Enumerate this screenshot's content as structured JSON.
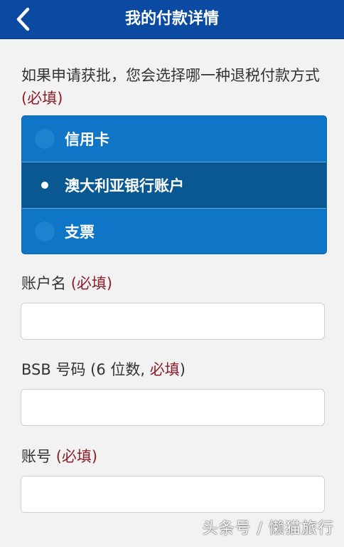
{
  "header": {
    "title": "我的付款详情",
    "back_icon": "chevron-left-icon"
  },
  "question": {
    "text": "如果申请获批，您会选择哪一种退税付款方式",
    "required": "(必填)"
  },
  "payment_options": [
    {
      "label": "信用卡",
      "selected": false
    },
    {
      "label": "澳大利亚银行账户",
      "selected": true
    },
    {
      "label": "支票",
      "selected": false
    }
  ],
  "fields": {
    "account_name": {
      "label": "账户名",
      "required": "(必填)",
      "value": ""
    },
    "bsb": {
      "label": "BSB 号码 (6 位数,",
      "required": "必填",
      "suffix": ")",
      "value": ""
    },
    "account_number": {
      "label": "账号",
      "required": "(必填)",
      "value": ""
    }
  },
  "watermark": "头条号 / 懒猫旅行",
  "colors": {
    "header_bg": "#0b4aa2",
    "option_bg": "#0f75c6",
    "option_selected_bg": "#0a5892",
    "required": "#8b1f2b",
    "page_bg": "#f2f2f2"
  }
}
